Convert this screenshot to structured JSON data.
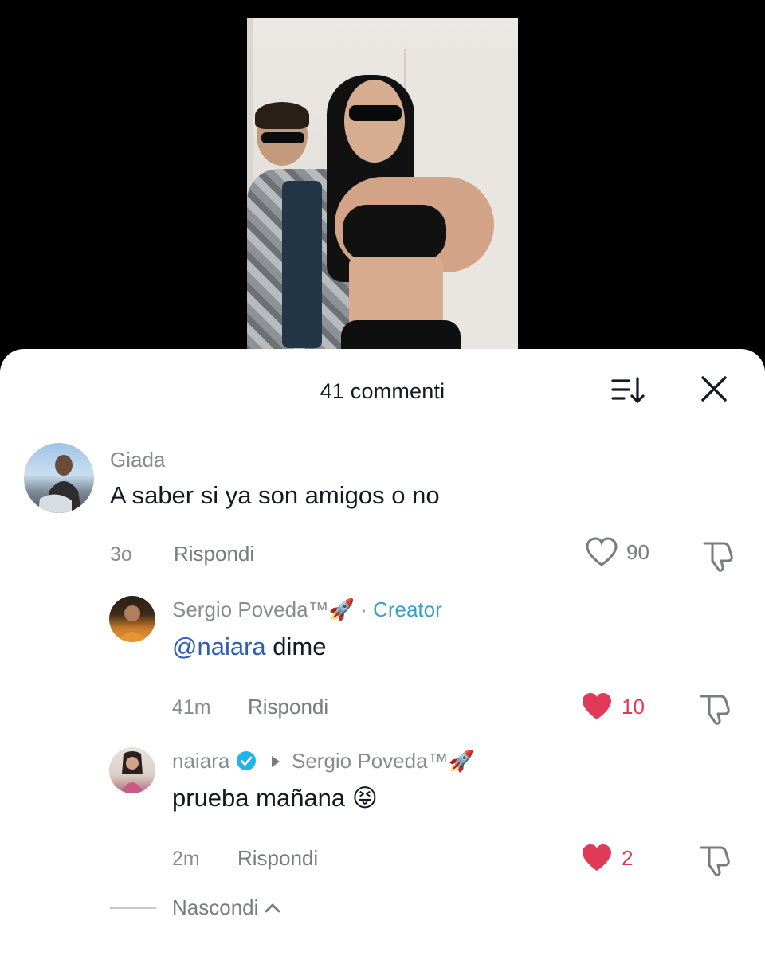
{
  "sheet": {
    "title": "41 commenti",
    "sort_icon": "sort-icon",
    "close_icon": "close-icon"
  },
  "comments": [
    {
      "username": "Giada",
      "text": "A saber si ya son amigos o no",
      "time": "3o",
      "reply_label": "Rispondi",
      "likes": "90",
      "liked": false
    },
    {
      "username": "Sergio Poveda™",
      "badge_emoji": "🚀",
      "separator": "·",
      "role": "Creator",
      "mention": "@naiara",
      "text": " dime",
      "time": "41m",
      "reply_label": "Rispondi",
      "likes": "10",
      "liked": true
    },
    {
      "username": "naiara",
      "reply_to": "Sergio Poveda™",
      "reply_to_emoji": "🚀",
      "text": "prueba mañana 😝",
      "time": "2m",
      "reply_label": "Rispondi",
      "likes": "2",
      "liked": true
    }
  ],
  "hide_replies_label": "Nascondi",
  "colors": {
    "liked_heart": "#e03a57",
    "creator": "#3aa0c8",
    "mention": "#2b5db5",
    "verified": "#20b5e6"
  }
}
